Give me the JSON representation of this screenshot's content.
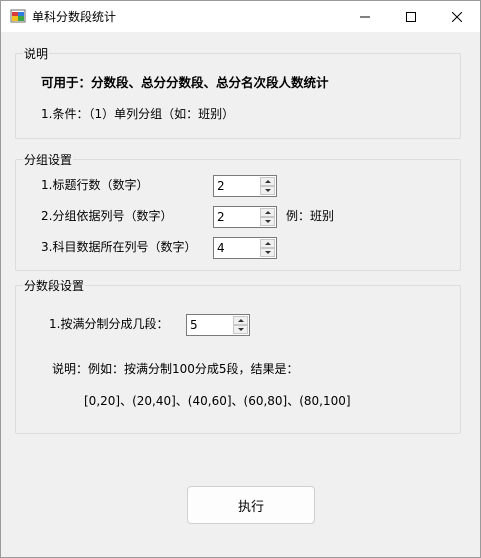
{
  "window": {
    "title": "单科分数段统计"
  },
  "group_info": {
    "title": "说明",
    "usage": "可用于：分数段、总分分数段、总分名次段人数统计",
    "condition": "1.条件：（1）单列分组（如：班别）"
  },
  "group_settings": {
    "title": "分组设置",
    "header_rows_label": "1.标题行数（数字）",
    "header_rows_value": "2",
    "group_col_label": "2.分组依据列号（数字）",
    "group_col_value": "2",
    "group_col_example": "例：班别",
    "subject_col_label": "3.科目数据所在列号（数字）",
    "subject_col_value": "4"
  },
  "group_segments": {
    "title": "分数段设置",
    "segments_label": "1.按满分制分成几段：",
    "segments_value": "5",
    "note": "说明：例如：按满分制100分成5段，结果是：",
    "result": "[0,20]、(20,40]、(40,60]、(60,80]、(80,100]"
  },
  "actions": {
    "execute_label": "执行"
  }
}
